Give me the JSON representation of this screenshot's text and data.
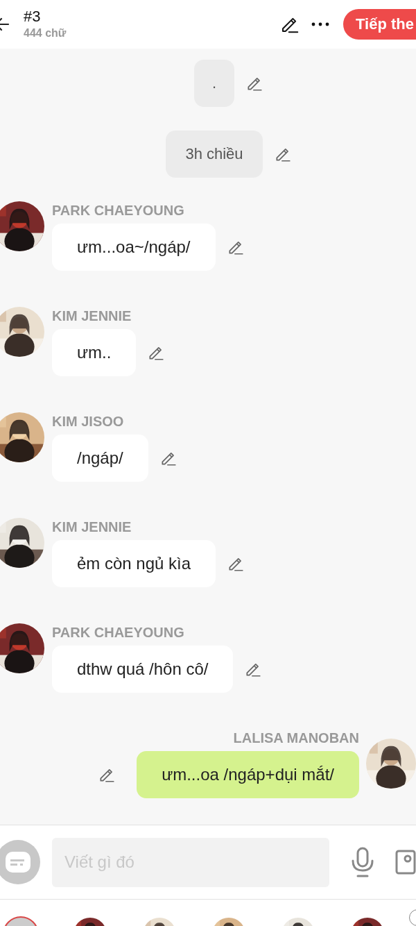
{
  "header": {
    "title": "#3",
    "word_count": "444 chữ",
    "next_button": "Tiếp the"
  },
  "messages": [
    {
      "kind": "narration",
      "text": "."
    },
    {
      "kind": "narration",
      "text": "3h chiều"
    },
    {
      "kind": "left",
      "name": "PARK CHAEYOUNG",
      "text": "ưm...oa~/ngáp/"
    },
    {
      "kind": "left",
      "name": "KIM JENNIE",
      "text": "ưm.."
    },
    {
      "kind": "left",
      "name": "KIM JISOO",
      "text": "/ngáp/"
    },
    {
      "kind": "left",
      "name": "KIM JENNIE",
      "text": "ẻm còn ngủ kìa"
    },
    {
      "kind": "left",
      "name": "PARK CHAEYOUNG",
      "text": "dthw quá /hôn cô/"
    },
    {
      "kind": "right",
      "name": "LALISA MANOBAN",
      "text": "ưm...oa /ngáp+dụi mắt/"
    }
  ],
  "composer": {
    "placeholder": "Viết gì đó"
  },
  "characters": [
    {
      "selected": true
    },
    {
      "selected": false
    },
    {
      "selected": false
    },
    {
      "selected": false
    },
    {
      "selected": false
    },
    {
      "selected": false
    }
  ]
}
